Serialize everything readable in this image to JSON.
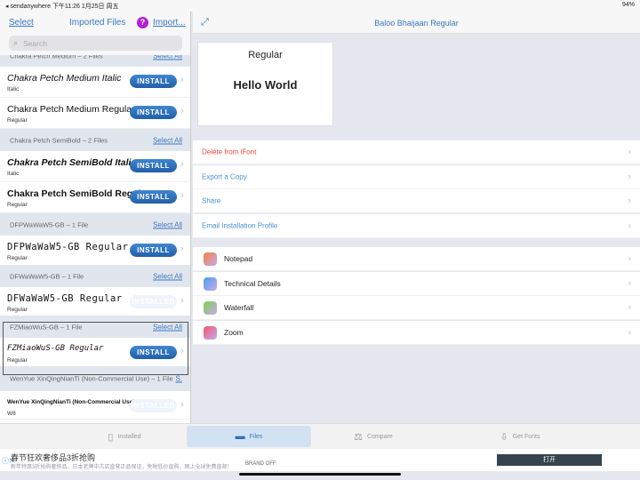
{
  "status": {
    "left": "◂ sendanywhere  下午11:26  1月25日 周五",
    "right": "94%"
  },
  "left": {
    "select": "Select",
    "title": "Imported Files",
    "import": "Import...",
    "search_placeholder": "Search",
    "sections": [
      {
        "title": "Chakra Petch Medium – 2 Files",
        "select_all": "Select All",
        "rows": [
          {
            "name": "Chakra Petch Medium Italic",
            "style": "Italic",
            "button": "INSTALL",
            "installed": false
          },
          {
            "name": "Chakra Petch Medium Regular",
            "style": "Regular",
            "button": "INSTALL",
            "installed": false
          }
        ]
      },
      {
        "title": "Chakra Petch SemiBold – 2 Files",
        "select_all": "Select All",
        "rows": [
          {
            "name": "Chakra Petch SemiBold Italic",
            "style": "Italic",
            "button": "INSTALL",
            "installed": false
          },
          {
            "name": "Chakra Petch SemiBold Regular",
            "style": "Regular",
            "button": "INSTALL",
            "installed": false
          }
        ]
      },
      {
        "title": "DFPWaWaW5-GB – 1 File",
        "select_all": "Select All",
        "rows": [
          {
            "name": "DFPWaWaW5-GB Regular",
            "style": "Regular",
            "button": "INSTALL",
            "installed": false
          }
        ]
      },
      {
        "title": "DFWaWaW5-GB – 1 File",
        "select_all": "Select All",
        "rows": [
          {
            "name": "DFWaWaW5-GB Regular",
            "style": "Regular",
            "button": "INSTALLED",
            "installed": true
          }
        ]
      },
      {
        "title": "FZMiaoWuS-GB – 1 File",
        "select_all": "Select All",
        "rows": [
          {
            "name": "FZMiaoWuS-GB Regular",
            "style": "Regular",
            "button": "INSTALL",
            "installed": false
          }
        ]
      },
      {
        "title": "WenYue XinQingNianTi (Non-Commercial Use) – 1 File",
        "select_all": "S.",
        "rows": [
          {
            "name": "WenYue XinQingNianTi (Non-Commercial Use) W8",
            "style": "W8",
            "button": "INSTALLED",
            "installed": true
          }
        ]
      }
    ]
  },
  "right": {
    "title": "Baloo Bhaijaan Regular",
    "preview_style": "Regular",
    "preview_text": "Hello World",
    "actions": [
      {
        "label": "Delete from iFont",
        "color": "#e8493c"
      },
      {
        "label": "Export a Copy",
        "color": "#4a8fd6"
      },
      {
        "label": "Share",
        "color": "#4a8fd6"
      },
      {
        "label": "Email Installation Profile",
        "color": "#4a8fd6"
      }
    ],
    "tools": [
      {
        "label": "Notepad",
        "icon": "notepad-icon",
        "color": "#f5823a"
      },
      {
        "label": "Technical Details",
        "icon": "compass-icon",
        "color": "#4aa0e8"
      },
      {
        "label": "Waterfall",
        "icon": "waterfall-icon",
        "color": "#7bd34a"
      },
      {
        "label": "Zoom",
        "icon": "magnifier-icon",
        "color": "#ee5a6a"
      }
    ]
  },
  "tabs": [
    {
      "label": "Installed",
      "active": false
    },
    {
      "label": "Files",
      "active": true
    },
    {
      "label": "Compare",
      "active": false
    },
    {
      "label": "Get Fonts",
      "active": false
    }
  ],
  "ad": {
    "title": "春节狂欢奢侈品3折抢购",
    "body": "新年特惠3折抢购奢侈品。日本老牌中古店直营正品保证，免税低价直购，网上全球免费直邮！",
    "brand": "BRAND OFF",
    "button": "打开"
  }
}
